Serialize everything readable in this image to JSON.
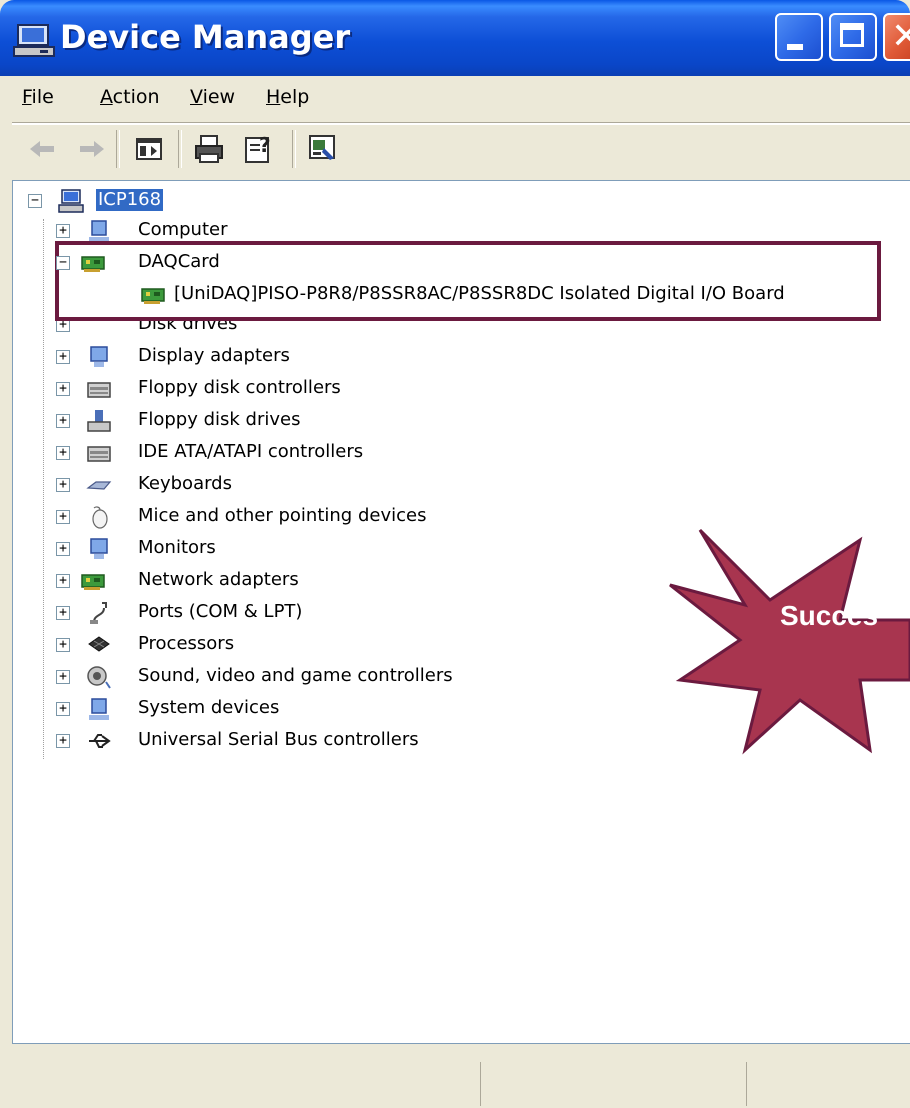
{
  "window": {
    "title": "Device Manager"
  },
  "menu": [
    {
      "label_u": "F",
      "label_rest": "ile"
    },
    {
      "label_u": "A",
      "label_rest": "ction"
    },
    {
      "label_u": "V",
      "label_rest": "iew"
    },
    {
      "label_u": "H",
      "label_rest": "elp"
    }
  ],
  "toolbar": {
    "back": "back-arrow-icon",
    "forward": "forward-arrow-icon",
    "show_hide": "show-hide-console-tree-icon",
    "print": "print-icon",
    "help": "help-icon",
    "properties": "properties-icon"
  },
  "tree": {
    "root": "ICP168",
    "computer": "Computer",
    "daqcard": "DAQCard",
    "daqcard_child": "[UniDAQ]PISO-P8R8/P8SSR8AC/P8SSR8DC Isolated Digital I/O Board",
    "disk_drives": "Disk drives",
    "display_adapters": "Display adapters",
    "floppy_controllers": "Floppy disk controllers",
    "floppy_drives": "Floppy disk drives",
    "ide": "IDE ATA/ATAPI controllers",
    "keyboards": "Keyboards",
    "mice": "Mice and other pointing devices",
    "monitors": "Monitors",
    "network": "Network adapters",
    "ports": "Ports (COM & LPT)",
    "processors": "Processors",
    "sound": "Sound, video and game controllers",
    "system": "System devices",
    "usb": "Universal Serial Bus controllers"
  },
  "callout": {
    "text": "Succes"
  },
  "colors": {
    "highlight_border": "#6B1A3F",
    "burst_fill": "#A8354F",
    "selection": "#316AC5"
  }
}
